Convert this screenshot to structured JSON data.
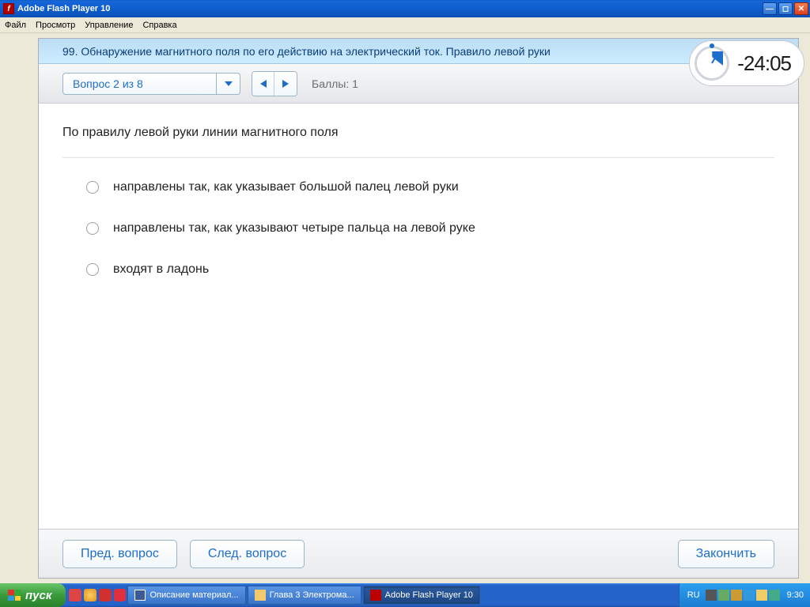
{
  "window": {
    "title": "Adobe Flash Player 10"
  },
  "menu": {
    "file": "Файл",
    "view": "Просмотр",
    "control": "Управление",
    "help": "Справка"
  },
  "header": {
    "title": "99. Обнаружение магнитного поля по его действию на электрический ток. Правило левой руки"
  },
  "controls": {
    "question_select": "Вопрос 2 из 8",
    "points_label": "Баллы:  1"
  },
  "timer": {
    "text": "-24:05"
  },
  "question": {
    "text": "По правилу левой руки линии магнитного поля",
    "options": [
      "направлены так, как указывает большой палец левой руки",
      "направлены так, как указывают четыре пальца на левой руке",
      "входят в ладонь"
    ]
  },
  "footer": {
    "prev": "Пред. вопрос",
    "next": "След. вопрос",
    "finish": "Закончить"
  },
  "taskbar": {
    "start": "пуск",
    "tasks": [
      "Описание материал...",
      "Глава 3  Электрома...",
      "Adobe Flash Player 10"
    ],
    "lang": "RU",
    "time": "9:30"
  }
}
